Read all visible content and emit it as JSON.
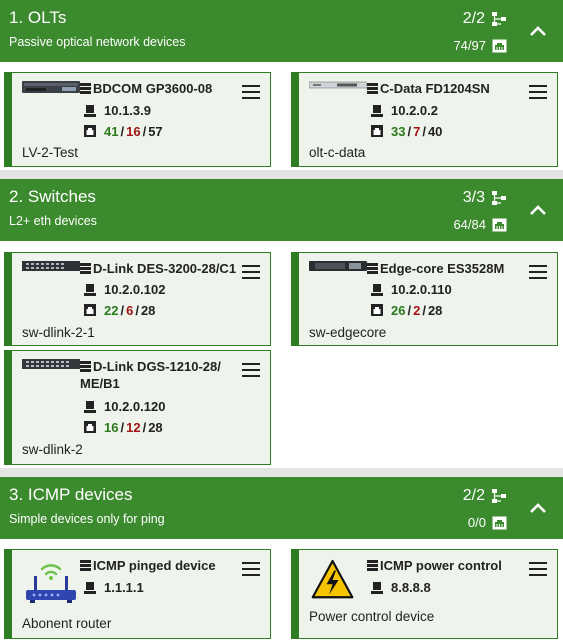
{
  "sections": [
    {
      "title": "1. OLTs",
      "subtitle": "Passive optical network devices",
      "devices": "2/2",
      "ports": "74/97",
      "cards": [
        {
          "model": "BDCOM GP3600-08",
          "ip": "10.1.3.9",
          "up": "41",
          "down": "16",
          "total": "57",
          "hostname": "LV-2-Test"
        },
        {
          "model": "C-Data FD1204SN",
          "ip": "10.2.0.2",
          "up": "33",
          "down": "7",
          "total": "40",
          "hostname": "olt-c-data"
        }
      ]
    },
    {
      "title": "2. Switches",
      "subtitle": "L2+ eth devices",
      "devices": "3/3",
      "ports": "64/84",
      "cards": [
        {
          "model": "D-Link DES-3200-28/C1",
          "ip": "10.2.0.102",
          "up": "22",
          "down": "6",
          "total": "28",
          "hostname": "sw-dlink-2-1"
        },
        {
          "model": "Edge-core ES3528M",
          "ip": "10.2.0.110",
          "up": "26",
          "down": "2",
          "total": "28",
          "hostname": "sw-edgecore"
        },
        {
          "model_line1": "D-Link DGS-1210-28/",
          "model_line2": "ME/B1",
          "ip": "10.2.0.120",
          "up": "16",
          "down": "12",
          "total": "28",
          "hostname": "sw-dlink-2"
        }
      ]
    },
    {
      "title": "3. ICMP devices",
      "subtitle": "Simple devices only for ping",
      "devices": "2/2",
      "ports": "0/0",
      "cards": [
        {
          "model": "ICMP pinged device",
          "ip": "1.1.1.1",
          "hostname": "Abonent router"
        },
        {
          "model": "ICMP power control",
          "ip": "8.8.8.8",
          "hostname": "Power control device"
        }
      ]
    }
  ],
  "slash": "/",
  "colors": {
    "header": "#3c8a2e",
    "card_border": "#2e7d22",
    "up": "#2a7a1c",
    "down": "#a31515"
  }
}
